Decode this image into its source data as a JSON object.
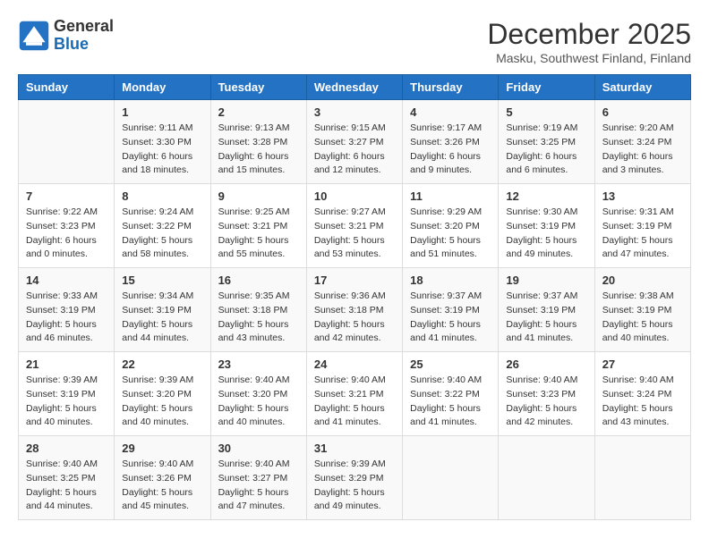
{
  "header": {
    "logo_line1": "General",
    "logo_line2": "Blue",
    "month": "December 2025",
    "location": "Masku, Southwest Finland, Finland"
  },
  "days_of_week": [
    "Sunday",
    "Monday",
    "Tuesday",
    "Wednesday",
    "Thursday",
    "Friday",
    "Saturday"
  ],
  "weeks": [
    [
      {
        "day": "",
        "info": ""
      },
      {
        "day": "1",
        "info": "Sunrise: 9:11 AM\nSunset: 3:30 PM\nDaylight: 6 hours\nand 18 minutes."
      },
      {
        "day": "2",
        "info": "Sunrise: 9:13 AM\nSunset: 3:28 PM\nDaylight: 6 hours\nand 15 minutes."
      },
      {
        "day": "3",
        "info": "Sunrise: 9:15 AM\nSunset: 3:27 PM\nDaylight: 6 hours\nand 12 minutes."
      },
      {
        "day": "4",
        "info": "Sunrise: 9:17 AM\nSunset: 3:26 PM\nDaylight: 6 hours\nand 9 minutes."
      },
      {
        "day": "5",
        "info": "Sunrise: 9:19 AM\nSunset: 3:25 PM\nDaylight: 6 hours\nand 6 minutes."
      },
      {
        "day": "6",
        "info": "Sunrise: 9:20 AM\nSunset: 3:24 PM\nDaylight: 6 hours\nand 3 minutes."
      }
    ],
    [
      {
        "day": "7",
        "info": "Sunrise: 9:22 AM\nSunset: 3:23 PM\nDaylight: 6 hours\nand 0 minutes."
      },
      {
        "day": "8",
        "info": "Sunrise: 9:24 AM\nSunset: 3:22 PM\nDaylight: 5 hours\nand 58 minutes."
      },
      {
        "day": "9",
        "info": "Sunrise: 9:25 AM\nSunset: 3:21 PM\nDaylight: 5 hours\nand 55 minutes."
      },
      {
        "day": "10",
        "info": "Sunrise: 9:27 AM\nSunset: 3:21 PM\nDaylight: 5 hours\nand 53 minutes."
      },
      {
        "day": "11",
        "info": "Sunrise: 9:29 AM\nSunset: 3:20 PM\nDaylight: 5 hours\nand 51 minutes."
      },
      {
        "day": "12",
        "info": "Sunrise: 9:30 AM\nSunset: 3:19 PM\nDaylight: 5 hours\nand 49 minutes."
      },
      {
        "day": "13",
        "info": "Sunrise: 9:31 AM\nSunset: 3:19 PM\nDaylight: 5 hours\nand 47 minutes."
      }
    ],
    [
      {
        "day": "14",
        "info": "Sunrise: 9:33 AM\nSunset: 3:19 PM\nDaylight: 5 hours\nand 46 minutes."
      },
      {
        "day": "15",
        "info": "Sunrise: 9:34 AM\nSunset: 3:19 PM\nDaylight: 5 hours\nand 44 minutes."
      },
      {
        "day": "16",
        "info": "Sunrise: 9:35 AM\nSunset: 3:18 PM\nDaylight: 5 hours\nand 43 minutes."
      },
      {
        "day": "17",
        "info": "Sunrise: 9:36 AM\nSunset: 3:18 PM\nDaylight: 5 hours\nand 42 minutes."
      },
      {
        "day": "18",
        "info": "Sunrise: 9:37 AM\nSunset: 3:19 PM\nDaylight: 5 hours\nand 41 minutes."
      },
      {
        "day": "19",
        "info": "Sunrise: 9:37 AM\nSunset: 3:19 PM\nDaylight: 5 hours\nand 41 minutes."
      },
      {
        "day": "20",
        "info": "Sunrise: 9:38 AM\nSunset: 3:19 PM\nDaylight: 5 hours\nand 40 minutes."
      }
    ],
    [
      {
        "day": "21",
        "info": "Sunrise: 9:39 AM\nSunset: 3:19 PM\nDaylight: 5 hours\nand 40 minutes."
      },
      {
        "day": "22",
        "info": "Sunrise: 9:39 AM\nSunset: 3:20 PM\nDaylight: 5 hours\nand 40 minutes."
      },
      {
        "day": "23",
        "info": "Sunrise: 9:40 AM\nSunset: 3:20 PM\nDaylight: 5 hours\nand 40 minutes."
      },
      {
        "day": "24",
        "info": "Sunrise: 9:40 AM\nSunset: 3:21 PM\nDaylight: 5 hours\nand 41 minutes."
      },
      {
        "day": "25",
        "info": "Sunrise: 9:40 AM\nSunset: 3:22 PM\nDaylight: 5 hours\nand 41 minutes."
      },
      {
        "day": "26",
        "info": "Sunrise: 9:40 AM\nSunset: 3:23 PM\nDaylight: 5 hours\nand 42 minutes."
      },
      {
        "day": "27",
        "info": "Sunrise: 9:40 AM\nSunset: 3:24 PM\nDaylight: 5 hours\nand 43 minutes."
      }
    ],
    [
      {
        "day": "28",
        "info": "Sunrise: 9:40 AM\nSunset: 3:25 PM\nDaylight: 5 hours\nand 44 minutes."
      },
      {
        "day": "29",
        "info": "Sunrise: 9:40 AM\nSunset: 3:26 PM\nDaylight: 5 hours\nand 45 minutes."
      },
      {
        "day": "30",
        "info": "Sunrise: 9:40 AM\nSunset: 3:27 PM\nDaylight: 5 hours\nand 47 minutes."
      },
      {
        "day": "31",
        "info": "Sunrise: 9:39 AM\nSunset: 3:29 PM\nDaylight: 5 hours\nand 49 minutes."
      },
      {
        "day": "",
        "info": ""
      },
      {
        "day": "",
        "info": ""
      },
      {
        "day": "",
        "info": ""
      }
    ]
  ]
}
